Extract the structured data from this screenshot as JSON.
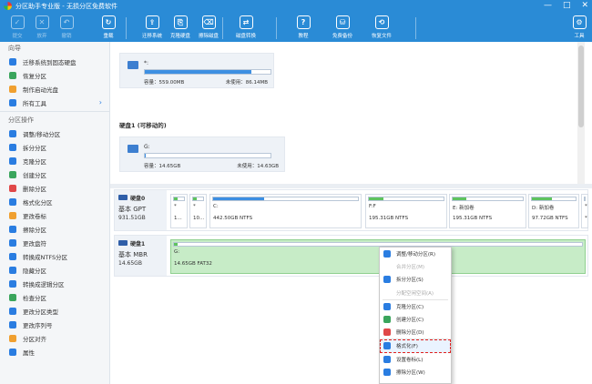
{
  "window": {
    "title": "分区助手专业版 - 无损分区免费软件",
    "min": "—",
    "max": "□",
    "close": "✕"
  },
  "toolbar": {
    "buttons": [
      {
        "id": "submit",
        "label": "提交",
        "glyph": "✓",
        "dim": true
      },
      {
        "id": "discard",
        "label": "放弃",
        "glyph": "✕",
        "dim": true
      },
      {
        "id": "undo",
        "label": "撤销",
        "glyph": "↶",
        "dim": true
      },
      {
        "id": "reload",
        "label": "重载",
        "glyph": "↻",
        "dim": false
      },
      {
        "id": "migrate",
        "label": "迁移系统",
        "glyph": "⇪",
        "dim": false
      },
      {
        "id": "clone-disk",
        "label": "克隆硬盘",
        "glyph": "⎘",
        "dim": false
      },
      {
        "id": "wipe-disk",
        "label": "擦除磁盘",
        "glyph": "⌫",
        "dim": false
      },
      {
        "id": "disk-convert",
        "label": "磁盘转换",
        "glyph": "⇄",
        "dim": false
      },
      {
        "id": "tutorial",
        "label": "教程",
        "glyph": "?",
        "dim": false
      },
      {
        "id": "free-backup",
        "label": "免费备份",
        "glyph": "⛁",
        "dim": false
      },
      {
        "id": "recover-files",
        "label": "恢复文件",
        "glyph": "⟲",
        "dim": false
      },
      {
        "id": "tools",
        "label": "工具",
        "glyph": "⚙",
        "dim": false
      }
    ]
  },
  "sidebar": {
    "wizard_head": "向导",
    "wizard_items": [
      {
        "label": "迁移系统到固态硬盘",
        "c": ""
      },
      {
        "label": "恢复分区",
        "c": "g"
      },
      {
        "label": "制作启动光盘",
        "c": "o"
      },
      {
        "label": "所有工具",
        "c": "",
        "arrow": "›"
      }
    ],
    "ops_head": "分区操作",
    "ops_items": [
      {
        "label": "调整/移动分区",
        "c": ""
      },
      {
        "label": "拆分分区",
        "c": ""
      },
      {
        "label": "克隆分区",
        "c": ""
      },
      {
        "label": "创建分区",
        "c": "g"
      },
      {
        "label": "删除分区",
        "c": "r"
      },
      {
        "label": "格式化分区",
        "c": ""
      },
      {
        "label": "更改卷标",
        "c": "o"
      },
      {
        "label": "擦除分区",
        "c": ""
      },
      {
        "label": "更改盘符",
        "c": ""
      },
      {
        "label": "转换成NTFS分区",
        "c": ""
      },
      {
        "label": "隐藏分区",
        "c": ""
      },
      {
        "label": "转换成逻辑分区",
        "c": ""
      },
      {
        "label": "检查分区",
        "c": "g"
      },
      {
        "label": "更改分区类型",
        "c": ""
      },
      {
        "label": "更改序列号",
        "c": ""
      },
      {
        "label": "分区对齐",
        "c": "o"
      },
      {
        "label": "属性",
        "c": ""
      }
    ]
  },
  "volumes": [
    {
      "name": "*:",
      "capacity": "容量：559.00MB",
      "free": "未使用：86.14MB",
      "used_pct": 85
    },
    {
      "name": "G:",
      "capacity": "容量：14.65GB",
      "free": "未使用：14.63GB",
      "used_pct": 1
    }
  ],
  "disk1_title": "硬盘1 (可移动的)",
  "disks": [
    {
      "name": "硬盘0",
      "type": "基本 GPT",
      "size": "931.51GB",
      "parts": [
        {
          "label": "*",
          "info": "1...",
          "used": 40
        },
        {
          "label": "*",
          "info": "10...",
          "used": 40
        },
        {
          "label": "C:",
          "info": "442.50GB NTFS",
          "used": 35
        },
        {
          "label": "F:F",
          "info": "195.31GB NTFS",
          "used": 20
        },
        {
          "label": "E: 新加卷",
          "info": "195.31GB NTFS",
          "used": 20
        },
        {
          "label": "D: 新加卷",
          "info": "97.72GB NTFS",
          "used": 45
        },
        {
          "label": "*",
          "info": "*",
          "used": 40
        }
      ]
    },
    {
      "name": "硬盘1",
      "type": "基本 MBR",
      "size": "14.65GB",
      "parts": [
        {
          "label": "G:",
          "info": "14.65GB FAT32",
          "used": 1
        }
      ]
    }
  ],
  "context_menu": [
    {
      "label": "调整/移动分区(R)",
      "c": "",
      "dis": false
    },
    {
      "label": "合并分区(M)",
      "c": "none",
      "dis": true
    },
    {
      "label": "拆分分区(S)",
      "c": "",
      "dis": false
    },
    {
      "label": "分配空闲空间(A)",
      "c": "none",
      "dis": true
    },
    {
      "label": "克隆分区(C)",
      "c": "",
      "dis": false
    },
    {
      "label": "创建分区(C)",
      "c": "g",
      "dis": false
    },
    {
      "label": "删除分区(D)",
      "c": "r",
      "dis": false
    },
    {
      "label": "格式化(F)",
      "c": "",
      "dis": false,
      "hl": true
    },
    {
      "label": "设置卷标(L)",
      "c": "",
      "dis": false
    },
    {
      "label": "擦除分区(W)",
      "c": "",
      "dis": false
    }
  ]
}
